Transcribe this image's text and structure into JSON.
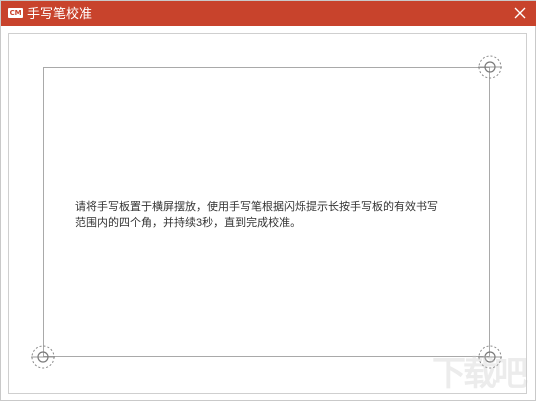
{
  "window": {
    "logo_text": "CM",
    "title": "手写笔校准",
    "accent_color": "#c8432c",
    "close_icon": "close-icon"
  },
  "calibration": {
    "instruction": "请将手写板置于横屏摆放，使用手写笔根据闪烁提示长按手写板的有效书写范围内的四个角，并持续3秒，直到完成校准。",
    "target_icon": "crosshair-target-icon"
  },
  "watermark": {
    "text": "下载吧"
  }
}
